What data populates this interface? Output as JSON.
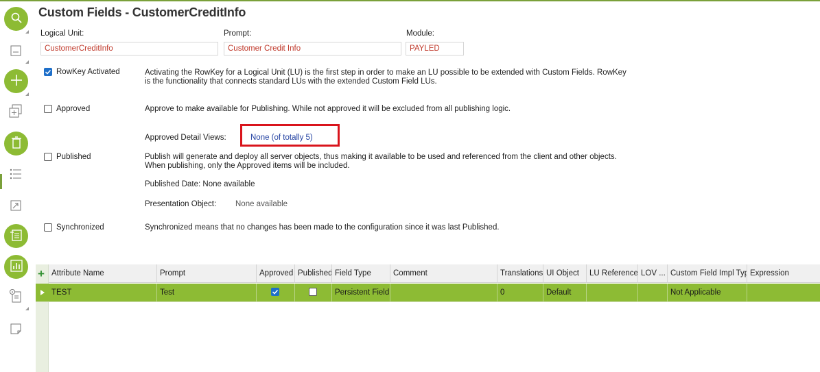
{
  "page": {
    "title": "Custom Fields - CustomerCreditInfo"
  },
  "header": {
    "logical_unit": {
      "label": "Logical Unit:",
      "value": "CustomerCreditInfo"
    },
    "prompt": {
      "label": "Prompt:",
      "value": "Customer Credit Info"
    },
    "module": {
      "label": "Module:",
      "value": "PAYLED"
    }
  },
  "options": {
    "rowkey": {
      "label": "RowKey Activated",
      "checked": true,
      "description_line1": "Activating the RowKey for a Logical Unit (LU) is the first step in order to make an LU possible to be extended with Custom Fields. RowKey",
      "description_line2": "is the functionality that connects standard LUs with the extended Custom Field LUs."
    },
    "approved": {
      "label": "Approved",
      "checked": false,
      "description": "Approve to make available for Publishing. While not approved it will be excluded from all publishing logic."
    },
    "approved_detail_views": {
      "label": "Approved Detail Views:",
      "value": "None (of totally 5)"
    },
    "published": {
      "label": "Published",
      "checked": false,
      "description_line1": "Publish will generate and deploy all server objects, thus making it available to be used and referenced from the client and other objects.",
      "description_line2": "When publishing, only the Approved items will be included."
    },
    "published_date": {
      "text": "Published Date: None available"
    },
    "presentation_object": {
      "label": "Presentation Object:",
      "value": "None available"
    },
    "synchronized": {
      "label": "Synchronized",
      "checked": false,
      "description": "Synchronized means that no changes has been made to the configuration since it was last Published."
    }
  },
  "grid": {
    "add_icon": "plus-icon",
    "columns": [
      "Attribute Name",
      "Prompt",
      "Approved",
      "Published",
      "Field Type",
      "Comment",
      "Translations",
      "UI Object",
      "LU Reference",
      "LOV ...",
      "Custom Field Impl Type",
      "Expression"
    ],
    "rows": [
      {
        "attribute_name": "TEST",
        "prompt": "Test",
        "approved": true,
        "published": false,
        "field_type": "Persistent Field",
        "comment": "",
        "translations": "0",
        "ui_object": "Default",
        "lu_reference": "",
        "lov": "",
        "impl_type": "Not Applicable",
        "expression": ""
      }
    ]
  },
  "toolbar": {
    "icons": [
      "search-icon",
      "form-icon",
      "add-icon",
      "duplicate-icon",
      "delete-icon",
      "list-icon",
      "open-link-icon",
      "detail-icon",
      "chart-icon",
      "info-icon",
      "note-icon"
    ]
  },
  "colors": {
    "accent": "#8dbb34",
    "highlight_border": "#d9141c",
    "field_text": "#c0392b",
    "link": "#1f3ea0"
  }
}
